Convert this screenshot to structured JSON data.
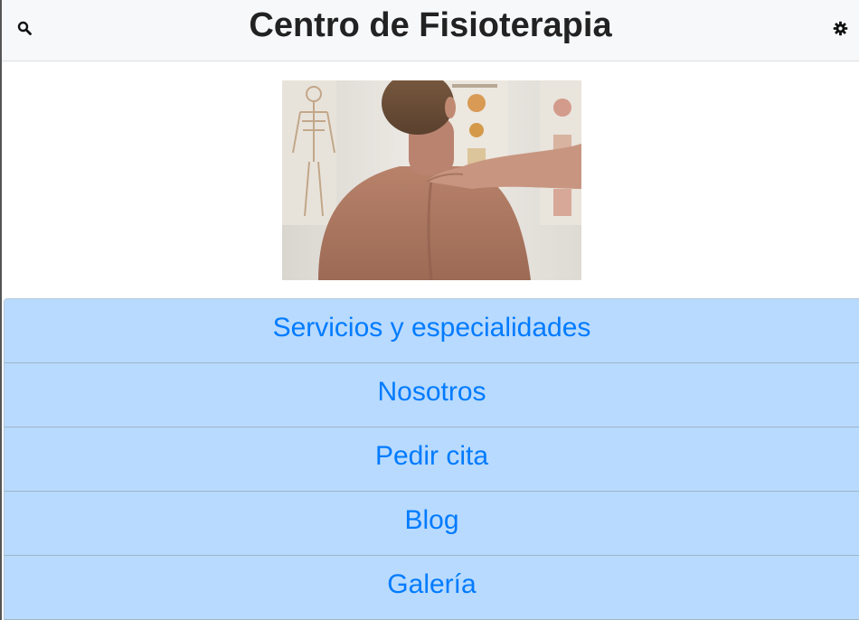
{
  "header": {
    "title": "Centro de Fisioterapia",
    "left_icon": "search-icon",
    "right_icon": "gear-icon"
  },
  "hero": {
    "image_subject": "physiotherapist-hand-on-patient-shoulder-photo"
  },
  "menu": {
    "items": [
      {
        "label": "Servicios y especialidades"
      },
      {
        "label": "Nosotros"
      },
      {
        "label": "Pedir cita"
      },
      {
        "label": "Blog"
      },
      {
        "label": "Galería"
      }
    ]
  },
  "colors": {
    "header_bg": "#f7f8fa",
    "menu_bg": "#b8daff",
    "menu_text": "#007bff",
    "title_text": "#222222"
  }
}
